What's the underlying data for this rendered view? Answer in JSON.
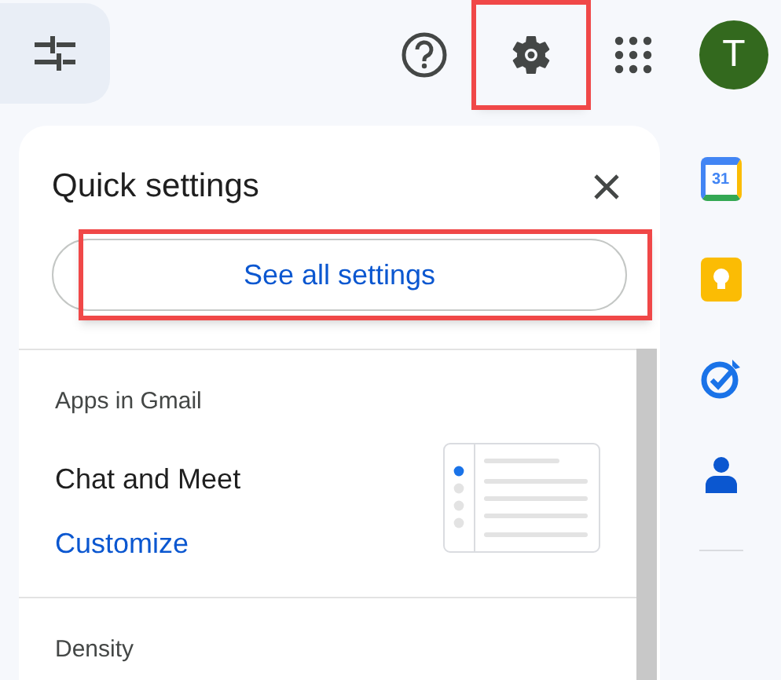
{
  "topbar": {
    "help": {
      "highlighted": false
    },
    "settings": {
      "highlighted": true
    },
    "avatar": {
      "letter": "T"
    }
  },
  "quick_settings": {
    "title": "Quick settings",
    "see_all": {
      "label": "See all settings",
      "highlighted": true
    },
    "sections": [
      {
        "heading": "Apps in Gmail",
        "item": "Chat and Meet",
        "link": "Customize"
      },
      {
        "heading": "Density"
      }
    ]
  },
  "side_rail": {
    "calendar_day": "31"
  }
}
